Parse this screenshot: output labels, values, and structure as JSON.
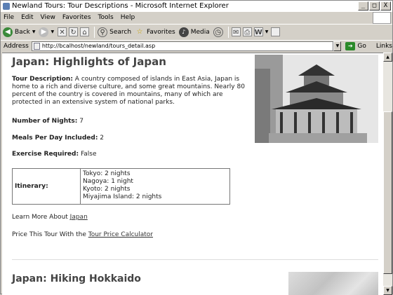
{
  "window": {
    "title": "Newland Tours: Tour Descriptions - Microsoft Internet Explorer",
    "buttons": {
      "minimize": "_",
      "maximize": "□",
      "close": "X"
    }
  },
  "menu": [
    "File",
    "Edit",
    "View",
    "Favorites",
    "Tools",
    "Help"
  ],
  "toolbar": {
    "back": "Back",
    "search": "Search",
    "favorites": "Favorites",
    "media": "Media"
  },
  "address": {
    "label": "Address",
    "value": "http://bcalhost/newland/tours_detail.asp",
    "go": "Go",
    "links": "Links"
  },
  "page": {
    "heading": "Japan: Highlights of Japan",
    "description_label": "Tour Description:",
    "description_text": "A country composed of islands in East Asia, Japan is home to a rich and diverse culture, and some great mountains. Nearly 80 percent of the country is covered in mountains, many of which are protected in an extensive system of national parks.",
    "nights_label": "Number of Nights:",
    "nights_value": "7",
    "meals_label": "Meals Per Day Included:",
    "meals_value": "2",
    "exercise_label": "Exercise Required:",
    "exercise_value": "False",
    "itinerary_label": "Itinerary:",
    "itinerary": [
      "Tokyo: 2 nights",
      "Nagoya: 1 night",
      "Kyoto: 2 nights",
      "Miyajima Island: 2 nights"
    ],
    "learn_more_text": "Learn More About",
    "learn_more_link": "Japan",
    "price_text": "Price This Tour With the",
    "price_link": "Tour Price Calculator",
    "next_heading": "Japan: Hiking Hokkaido"
  }
}
